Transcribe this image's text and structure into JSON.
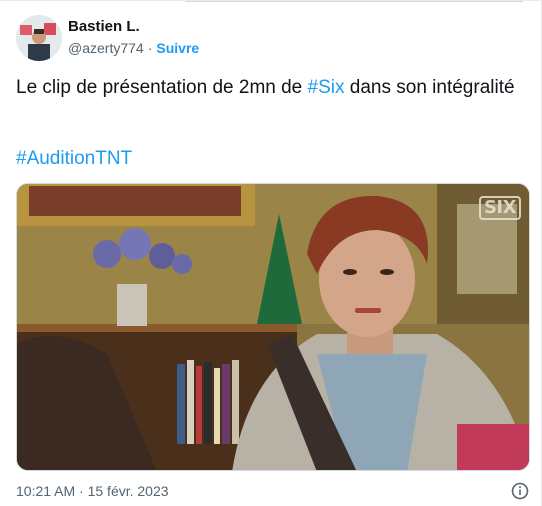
{
  "author": {
    "name": "Bastien L.",
    "handle": "@azerty774",
    "separator": "·",
    "follow_label": "Suivre"
  },
  "tweet": {
    "text_part1": "Le clip de présentation de 2mn de ",
    "hashtag_inline": "#Six",
    "text_part2": " dans son intégralité",
    "hashtag_line": "#AuditionTNT"
  },
  "media": {
    "watermark": "SIX"
  },
  "footer": {
    "timestamp": "10:21 AM · 15 févr. 2023"
  },
  "colors": {
    "link": "#1d9bf0",
    "text": "#0f1419",
    "muted": "#536471"
  },
  "icons": {
    "info": "info-icon"
  }
}
